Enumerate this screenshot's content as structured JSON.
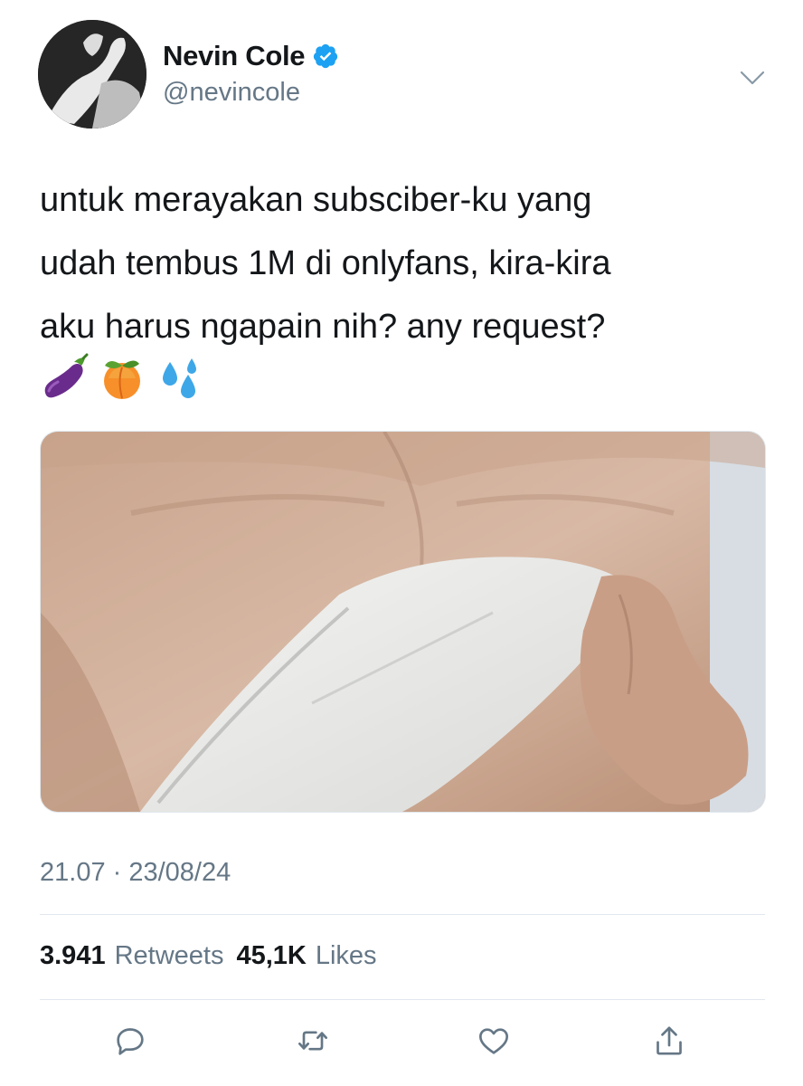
{
  "tweet": {
    "author": {
      "display_name": "Nevin Cole",
      "handle": "@nevincole",
      "verified": true
    },
    "text_lines": [
      "untuk merayakan subsciber-ku yang",
      "udah tembus 1M di onlyfans, kira-kira",
      "aku harus ngapain nih? any request?"
    ],
    "emojis": [
      "eggplant",
      "peach",
      "sweat-droplets"
    ],
    "timestamp": "21.07 · 23/08/24",
    "stats": {
      "retweets_count": "3.941",
      "retweets_label": "Retweets",
      "likes_count": "45,1K",
      "likes_label": "Likes"
    },
    "actions": [
      "reply-icon",
      "retweet-icon",
      "like-icon",
      "share-icon"
    ]
  },
  "colors": {
    "text_primary": "#14171a",
    "text_secondary": "#657786",
    "verified_blue": "#1da1f2",
    "divider": "#e1e8ed"
  }
}
